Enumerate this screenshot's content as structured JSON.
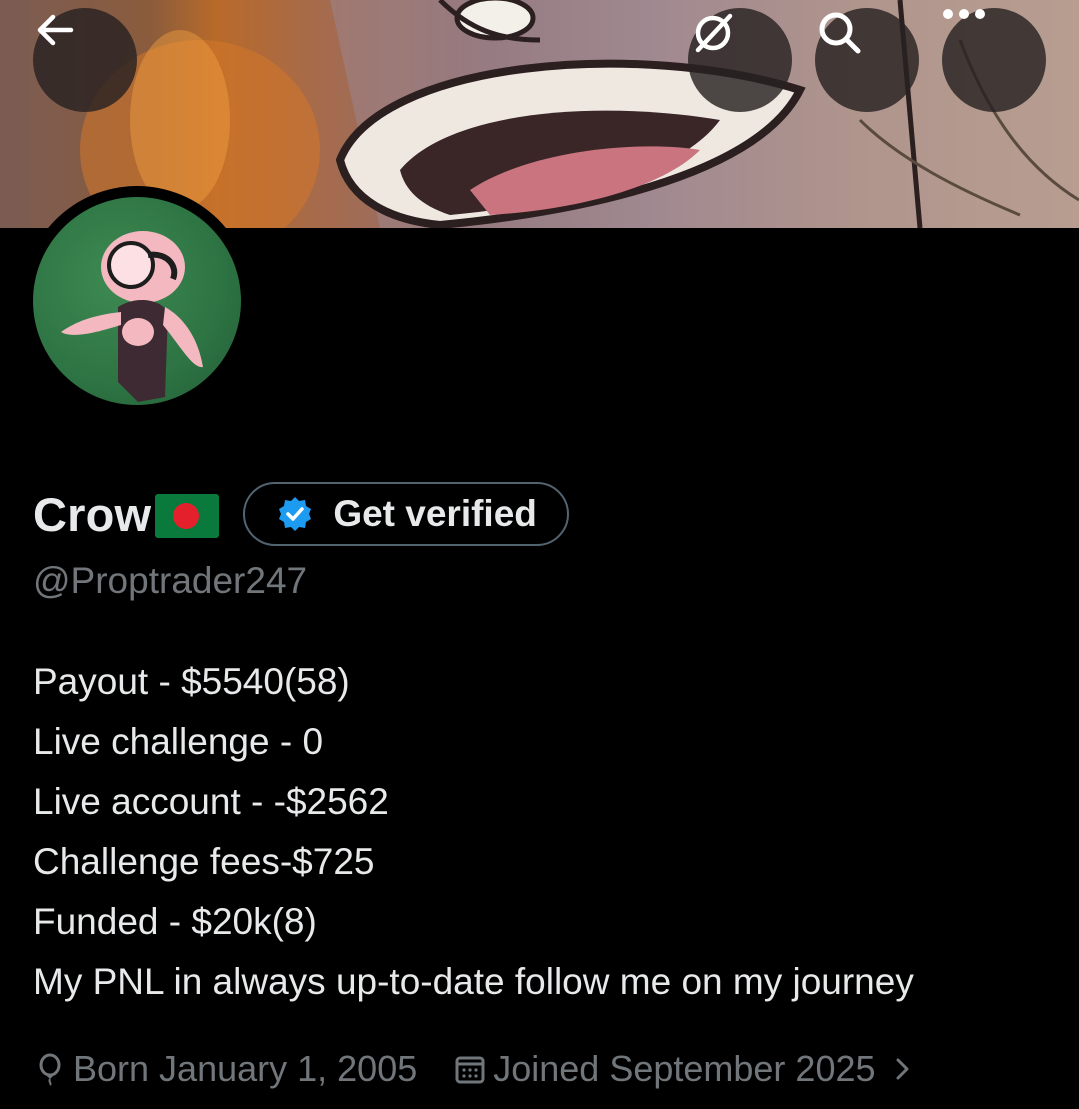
{
  "header": {
    "back_icon": "arrow-left-icon",
    "actions": [
      {
        "icon": "grok-icon"
      },
      {
        "icon": "search-icon"
      },
      {
        "icon": "more-icon"
      }
    ]
  },
  "profile": {
    "name": "Crow",
    "flag_emoji": "🇧🇩",
    "verify_button_label": "Get verified",
    "handle": "@Proptrader247",
    "bio_lines": [
      "Payout - $5540(58)",
      "Live challenge - 0",
      "Live account - -$2562",
      "Challenge fees-$725",
      "Funded - $20k(8)",
      "My PNL in always up-to-date follow me on my journey"
    ],
    "birthday": "Born January 1, 2005",
    "joined": "Joined September 2025"
  },
  "colors": {
    "background": "#000000",
    "text_primary": "#e7e9ea",
    "text_secondary": "#71767b",
    "pill_border": "#536471",
    "verified_blue": "#1d9bf0"
  }
}
